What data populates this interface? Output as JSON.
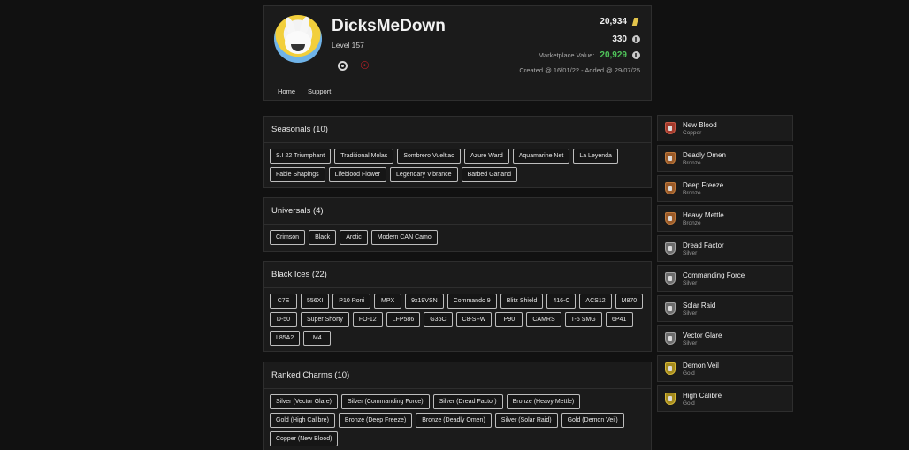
{
  "profile": {
    "username": "DicksMeDown",
    "level": "Level 157",
    "credits": "20,934",
    "renown": "330",
    "marketplace_label": "Marketplace Value:",
    "marketplace_value": "20,929",
    "created": "Created @ 16/01/22 - Added @ 29/07/25"
  },
  "nav": {
    "home": "Home",
    "support": "Support"
  },
  "sections": {
    "seasonals": {
      "title": "Seasonals (10)",
      "items": [
        "S.I 22 Triumphant",
        "Traditional Molas",
        "Sombrero Vueltiao",
        "Azure Ward",
        "Aquamarine Net",
        "La Leyenda",
        "Fable Shapings",
        "Lifeblood Flower",
        "Legendary Vibrance",
        "Barbed Garland"
      ]
    },
    "universals": {
      "title": "Universals (4)",
      "items": [
        "Crimson",
        "Black",
        "Arctic",
        "Modern CAN Camo"
      ]
    },
    "blackices": {
      "title": "Black Ices (22)",
      "items": [
        "C7E",
        "556XI",
        "P10 Roni",
        "MPX",
        "9x19VSN",
        "Commando 9",
        "Blitz Shield",
        "416-C",
        "ACS12",
        "M870",
        "D-50",
        "Super Shorty",
        "FO-12",
        "LFP586",
        "G36C",
        "C8-SFW",
        "P90",
        "CAMRS",
        "T-5 SMG",
        "6P41",
        "L85A2",
        "M4"
      ]
    },
    "ranked": {
      "title": "Ranked Charms (10)",
      "items": [
        "Silver (Vector Glare)",
        "Silver (Commanding Force)",
        "Silver (Dread Factor)",
        "Bronze (Heavy Mettle)",
        "Gold (High Calibre)",
        "Bronze (Deep Freeze)",
        "Bronze (Deadly Omen)",
        "Silver (Solar Raid)",
        "Gold (Demon Veil)",
        "Copper (New Blood)"
      ]
    }
  },
  "charms": [
    {
      "name": "New Blood",
      "tier": "Copper"
    },
    {
      "name": "Deadly Omen",
      "tier": "Bronze"
    },
    {
      "name": "Deep Freeze",
      "tier": "Bronze"
    },
    {
      "name": "Heavy Mettle",
      "tier": "Bronze"
    },
    {
      "name": "Dread Factor",
      "tier": "Silver"
    },
    {
      "name": "Commanding Force",
      "tier": "Silver"
    },
    {
      "name": "Solar Raid",
      "tier": "Silver"
    },
    {
      "name": "Vector Glare",
      "tier": "Silver"
    },
    {
      "name": "Demon Veil",
      "tier": "Gold"
    },
    {
      "name": "High Calibre",
      "tier": "Gold"
    }
  ],
  "colors": {
    "background": "#111111",
    "panel": "#1b1b1b",
    "market_value": "#4fc35a",
    "platform_ps": "#e0202b"
  },
  "icons": {
    "credits": "gold-bars-icon",
    "renown": "renown-coin-icon",
    "platform_ubisoft": "ubisoft-icon",
    "platform_ps": "playstation-icon"
  }
}
